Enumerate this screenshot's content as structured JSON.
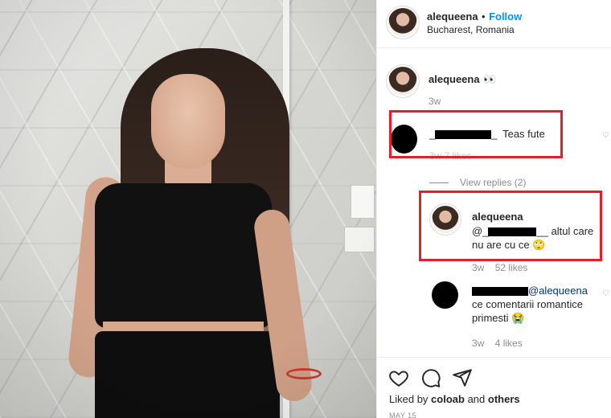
{
  "post": {
    "username": "alequeena",
    "dot": "•",
    "follow_label": "Follow",
    "location": "Bucharest, Romania"
  },
  "caption": {
    "username": "alequeena",
    "emoji": "👀",
    "time": "3w"
  },
  "comment1": {
    "username_prefix": "_",
    "username_suffix": "_",
    "text": "Teas fute",
    "meta": "3w  7 likes"
  },
  "view_replies": "View replies (2)",
  "reply1": {
    "username": "alequeena",
    "mention_prefix": "@_",
    "mention_suffix": "__",
    "text": "altul care nu are cu ce",
    "emoji": "🙄",
    "time": "3w",
    "likes": "52 likes"
  },
  "reply2": {
    "mention": "@alequeena",
    "text": "ce comentarii romantice primesti",
    "emoji": "😭",
    "time": "3w",
    "likes": "4 likes"
  },
  "footer": {
    "liked_by_prefix": "Liked by",
    "liked_user": "coloab",
    "and": "and",
    "others": "others",
    "date": "MAY 15"
  },
  "icons": [
    "heart-icon",
    "comment-icon",
    "share-icon",
    "small-heart-icon"
  ],
  "colors": {
    "follow": "#0095f6",
    "redbox": "#e0202c",
    "meta": "#8e8e8e"
  }
}
